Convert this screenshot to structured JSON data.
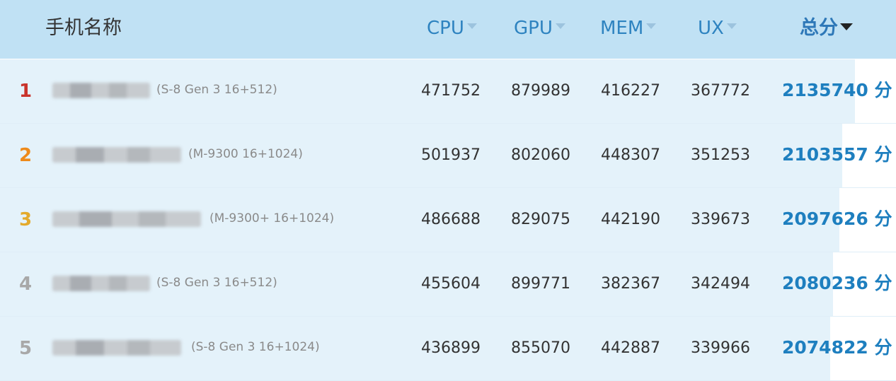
{
  "header": {
    "name": "手机名称",
    "cpu": "CPU",
    "gpu": "GPU",
    "mem": "MEM",
    "ux": "UX",
    "total": "总分"
  },
  "colors": {
    "rank_1": "#c9342c",
    "rank_2": "#ee8a1a",
    "rank_3": "#e3aa2c",
    "rank_other": "#a8a8a8"
  },
  "rows": [
    {
      "rank": "1",
      "chip": "(S-8 Gen 3 16+512)",
      "cpu": "471752",
      "gpu": "879989",
      "mem": "416227",
      "ux": "367772",
      "score": "2135740 分",
      "score_ratio": 1.0
    },
    {
      "rank": "2",
      "chip": "(M-9300 16+1024)",
      "cpu": "501937",
      "gpu": "802060",
      "mem": "448307",
      "ux": "351253",
      "score": "2103557 分",
      "score_ratio": 0.985
    },
    {
      "rank": "3",
      "chip": "(M-9300+ 16+1024)",
      "cpu": "486688",
      "gpu": "829075",
      "mem": "442190",
      "ux": "339673",
      "score": "2097626 分",
      "score_ratio": 0.982
    },
    {
      "rank": "4",
      "chip": "(S-8 Gen 3 16+512)",
      "cpu": "455604",
      "gpu": "899771",
      "mem": "382367",
      "ux": "342494",
      "score": "2080236 分",
      "score_ratio": 0.974
    },
    {
      "rank": "5",
      "chip": "(S-8 Gen 3 16+1024)",
      "cpu": "436899",
      "gpu": "855070",
      "mem": "442887",
      "ux": "339966",
      "score": "2074822 分",
      "score_ratio": 0.971
    }
  ]
}
